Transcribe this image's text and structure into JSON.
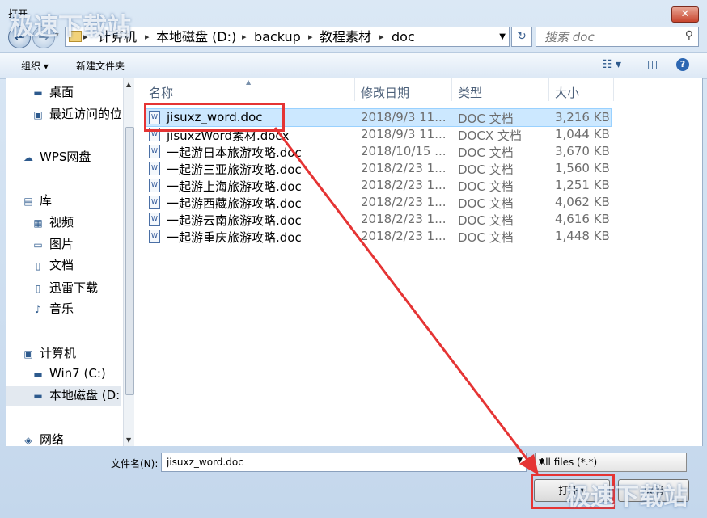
{
  "window": {
    "title": "打开",
    "close_glyph": "✕"
  },
  "nav": {
    "back_glyph": "←",
    "forward_glyph": "→",
    "breadcrumb": [
      "计算机",
      "本地磁盘 (D:)",
      "backup",
      "教程素材",
      "doc"
    ],
    "separator": "▸",
    "search_placeholder": "搜索 doc"
  },
  "toolbar": {
    "organize": "组织 ▾",
    "new_folder": "新建文件夹"
  },
  "sidebar": {
    "items": [
      {
        "label": "桌面",
        "icon": "desktop-icon"
      },
      {
        "label": "最近访问的位置",
        "icon": "recent-places-icon"
      },
      {
        "label": "WPS网盘",
        "icon": "cloud-icon"
      },
      {
        "label": "库",
        "icon": "library-icon"
      },
      {
        "label": "视频",
        "icon": "video-icon"
      },
      {
        "label": "图片",
        "icon": "picture-icon"
      },
      {
        "label": "文档",
        "icon": "document-icon"
      },
      {
        "label": "迅雷下载",
        "icon": "download-icon"
      },
      {
        "label": "音乐",
        "icon": "music-icon"
      },
      {
        "label": "计算机",
        "icon": "computer-icon"
      },
      {
        "label": "Win7 (C:)",
        "icon": "drive-icon"
      },
      {
        "label": "本地磁盘 (D:)",
        "icon": "drive-icon"
      },
      {
        "label": "网络",
        "icon": "network-icon"
      }
    ]
  },
  "columns": {
    "name": "名称",
    "modified": "修改日期",
    "type": "类型",
    "size": "大小"
  },
  "files": [
    {
      "name": "jisuxz_word.doc",
      "modified": "2018/9/3 11...",
      "type": "DOC 文档",
      "size": "3,216 KB",
      "selected": true
    },
    {
      "name": "jisuxzWord素材.docx",
      "modified": "2018/9/3 11...",
      "type": "DOCX 文档",
      "size": "1,044 KB"
    },
    {
      "name": "一起游日本旅游攻略.doc",
      "modified": "2018/10/15 ...",
      "type": "DOC 文档",
      "size": "3,670 KB"
    },
    {
      "name": "一起游三亚旅游攻略.doc",
      "modified": "2018/2/23 1...",
      "type": "DOC 文档",
      "size": "1,560 KB"
    },
    {
      "name": "一起游上海旅游攻略.doc",
      "modified": "2018/2/23 1...",
      "type": "DOC 文档",
      "size": "1,251 KB"
    },
    {
      "name": "一起游西藏旅游攻略.doc",
      "modified": "2018/2/23 1...",
      "type": "DOC 文档",
      "size": "4,062 KB"
    },
    {
      "name": "一起游云南旅游攻略.doc",
      "modified": "2018/2/23 1...",
      "type": "DOC 文档",
      "size": "4,616 KB"
    },
    {
      "name": "一起游重庆旅游攻略.doc",
      "modified": "2018/2/23 1...",
      "type": "DOC 文档",
      "size": "1,448 KB"
    }
  ],
  "bottom": {
    "filename_label": "文件名(N):",
    "filename_value": "jisuxz_word.doc",
    "filter_value": "All files (*.*)",
    "open_button": "打开",
    "cancel_button": "取消"
  },
  "watermark": "极速下载站",
  "annotation_color": "#e53434"
}
